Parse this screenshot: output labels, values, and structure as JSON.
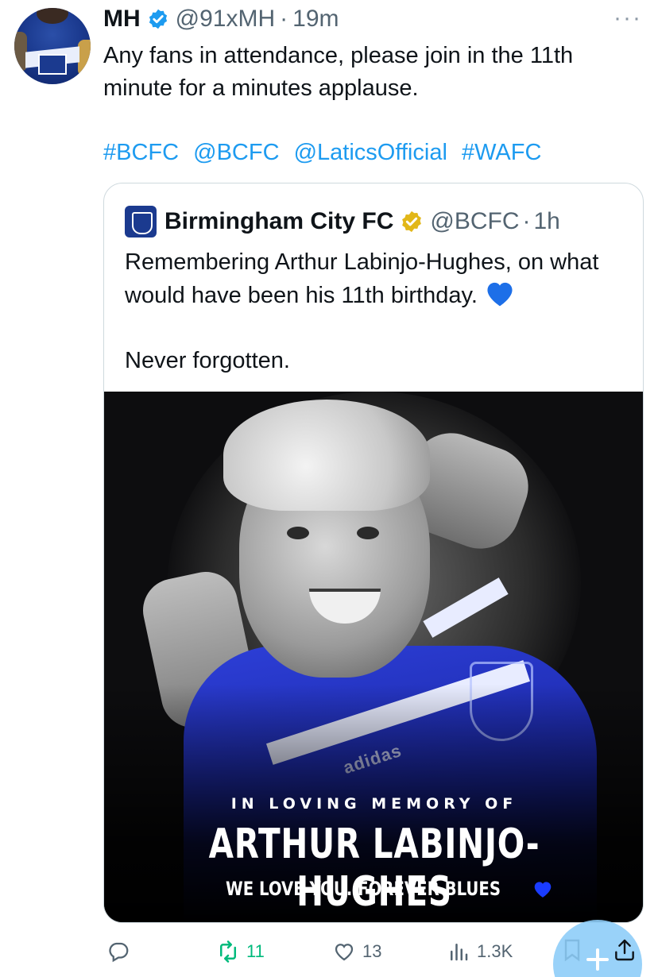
{
  "tweet": {
    "author_name": "MH",
    "handle": "@91xMH",
    "separator": "·",
    "time": "19m",
    "more": "···",
    "text": "Any fans in attendance, please join in the 11th minute for a minutes applause.",
    "tags": [
      "#BCFC",
      "@BCFC",
      "@LaticsOfficial",
      "#WAFC"
    ]
  },
  "quote": {
    "author_name": "Birmingham City FC",
    "handle": "@BCFC",
    "separator": "·",
    "time": "1h",
    "text_line1": "Remembering Arthur Labinjo-Hughes, on what would have been his 11th birthday.",
    "text_line2": "Never forgotten.",
    "image": {
      "sub_heading": "IN LOVING MEMORY OF",
      "name": "ARTHUR LABINJO-HUGHES",
      "tagline": "WE LOVE YOU. FOREVER BLUES",
      "shirt_brand": "adidas"
    }
  },
  "actions": {
    "replies": "",
    "retweets": "11",
    "likes": "13",
    "views": "1.3K"
  },
  "colors": {
    "link": "#1d9bf0",
    "muted": "#536471",
    "retweet": "#00ba7c",
    "verified_blue": "#1d9bf0",
    "verified_gold": "#e2b719",
    "heart_blue": "#1d4ed8",
    "fab": "#8ecdf8"
  }
}
